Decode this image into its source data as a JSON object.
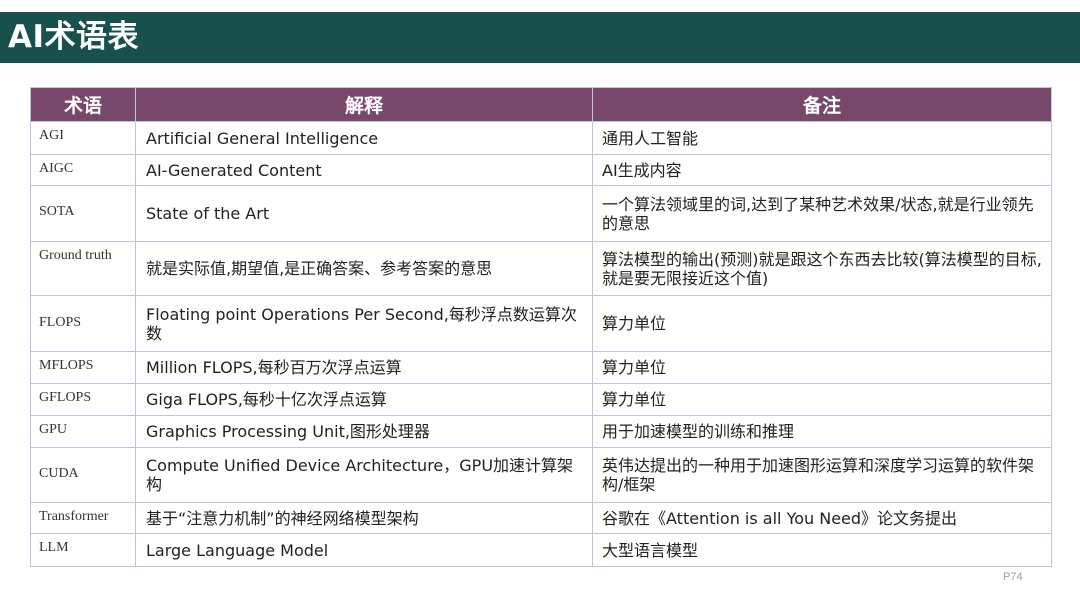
{
  "title": "AI术语表",
  "table": {
    "headers": {
      "term": "术语",
      "explanation": "解释",
      "note": "备注"
    },
    "rows": [
      {
        "term": "AGI",
        "explanation": "Artificial General Intelligence",
        "note": "通用人工智能"
      },
      {
        "term": "AIGC",
        "explanation": "AI-Generated Content",
        "note": "AI生成内容"
      },
      {
        "term": "SOTA",
        "explanation": "State of the Art",
        "note": "一个算法领域里的词,达到了某种艺术效果/状态,就是行业领先的意思"
      },
      {
        "term": "Ground truth",
        "explanation": "就是实际值,期望值,是正确答案、参考答案的意思",
        "note": "算法模型的输出(预测)就是跟这个东西去比较(算法模型的目标,就是要无限接近这个值)"
      },
      {
        "term": "FLOPS",
        "explanation": "Floating point Operations Per Second,每秒浮点数运算次数",
        "note": "算力单位"
      },
      {
        "term": "MFLOPS",
        "explanation": "Million FLOPS,每秒百万次浮点运算",
        "note": "算力单位"
      },
      {
        "term": "GFLOPS",
        "explanation": "Giga FLOPS,每秒十亿次浮点运算",
        "note": "算力单位"
      },
      {
        "term": "GPU",
        "explanation": "Graphics Processing Unit,图形处理器",
        "note": "用于加速模型的训练和推理"
      },
      {
        "term": "CUDA",
        "explanation": "Compute Unified Device Architecture，GPU加速计算架构",
        "note": "英伟达提出的一种用于加速图形运算和深度学习运算的软件架构/框架"
      },
      {
        "term": "Transformer",
        "explanation": "基于“注意力机制”的神经网络模型架构",
        "note": "谷歌在《Attention is all You Need》论文务提出"
      },
      {
        "term": "LLM",
        "explanation": "Large Language Model",
        "note": "大型语言模型"
      }
    ]
  },
  "page_number": "P74",
  "colors": {
    "title_bar": "#17504c",
    "header_bg": "#78486a",
    "border": "#b9c6de"
  }
}
